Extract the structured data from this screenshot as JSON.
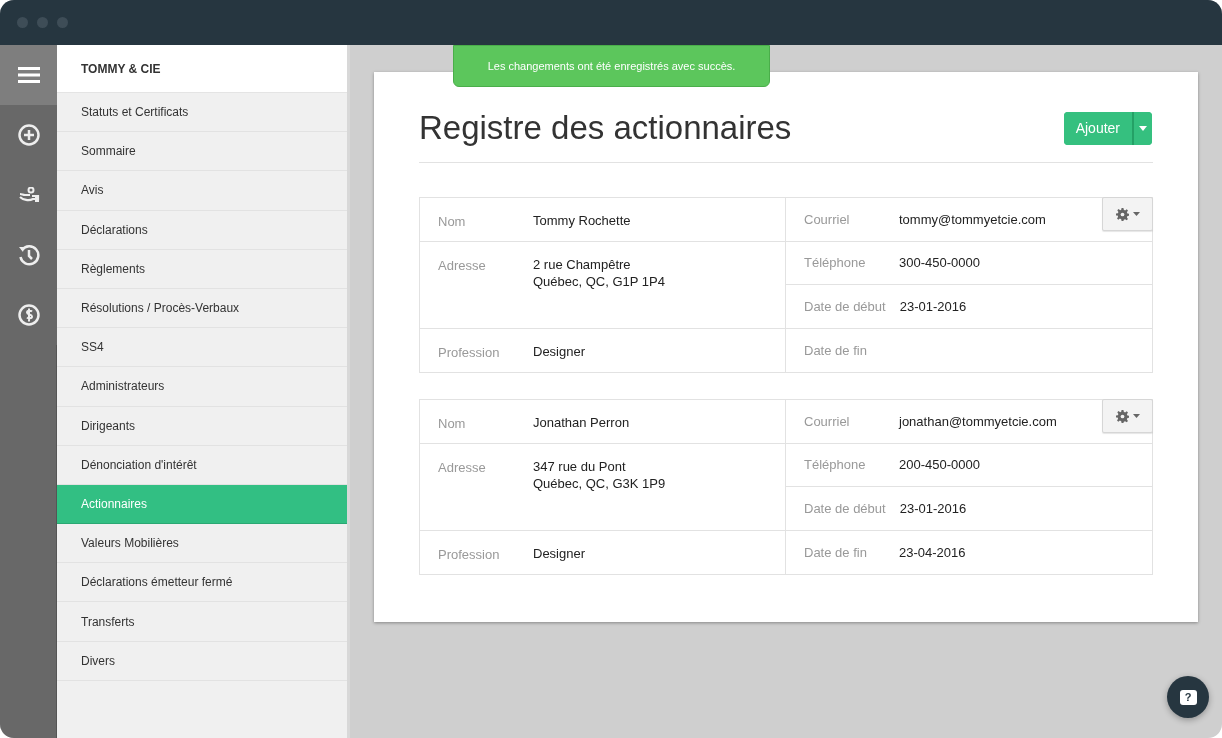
{
  "rail": {
    "items": [
      {
        "kind": "menu",
        "selected": true
      },
      {
        "kind": "add",
        "selected": false
      },
      {
        "kind": "hand",
        "selected": false
      },
      {
        "kind": "history",
        "selected": false
      },
      {
        "kind": "dollar",
        "selected": false
      }
    ]
  },
  "sidebar": {
    "title": "TOMMY & CIE",
    "items": [
      {
        "label": "Statuts et Certificats",
        "selected": false
      },
      {
        "label": "Sommaire",
        "selected": false
      },
      {
        "label": "Avis",
        "selected": false
      },
      {
        "label": "Déclarations",
        "selected": false
      },
      {
        "label": "Règlements",
        "selected": false
      },
      {
        "label": "Résolutions / Procès-Verbaux",
        "selected": false
      },
      {
        "label": "SS4",
        "selected": false
      },
      {
        "label": "Administrateurs",
        "selected": false
      },
      {
        "label": "Dirigeants",
        "selected": false
      },
      {
        "label": "Dénonciation d'intérêt",
        "selected": false
      },
      {
        "label": "Actionnaires",
        "selected": true
      },
      {
        "label": "Valeurs Mobilières",
        "selected": false
      },
      {
        "label": "Déclarations émetteur fermé",
        "selected": false
      },
      {
        "label": "Transferts",
        "selected": false
      },
      {
        "label": "Divers",
        "selected": false
      }
    ]
  },
  "toast": "Les changements ont été enregistrés avec succès.",
  "page": {
    "title": "Registre des actionnaires",
    "add_button": "Ajouter"
  },
  "records": [
    {
      "left": [
        {
          "label": "Nom",
          "value": [
            "Tommy Rochette"
          ]
        },
        {
          "label": "Adresse",
          "value": [
            "2 rue Champêtre",
            "Québec, QC, G1P 1P4"
          ]
        },
        {
          "label": "Profession",
          "value": [
            "Designer"
          ]
        }
      ],
      "right": [
        {
          "label": "Courriel",
          "value": "tommy@tommyetcie.com"
        },
        {
          "label": "Téléphone",
          "value": "300-450-0000"
        },
        {
          "label": "Date de début",
          "value": "23-01-2016"
        },
        {
          "label": "Date de fin"
        }
      ]
    },
    {
      "left": [
        {
          "label": "Nom",
          "value": [
            "Jonathan Perron"
          ]
        },
        {
          "label": "Adresse",
          "value": [
            "347 rue du Pont",
            "Québec, QC, G3K 1P9"
          ]
        },
        {
          "label": "Profession",
          "value": [
            "Designer"
          ]
        }
      ],
      "right": [
        {
          "label": "Courriel",
          "value": "jonathan@tommyetcie.com"
        },
        {
          "label": "Téléphone",
          "value": "200-450-0000"
        },
        {
          "label": "Date de début",
          "value": "23-01-2016"
        },
        {
          "label": "Date de fin",
          "value": "23-04-2016"
        }
      ]
    }
  ],
  "help_button": "?"
}
